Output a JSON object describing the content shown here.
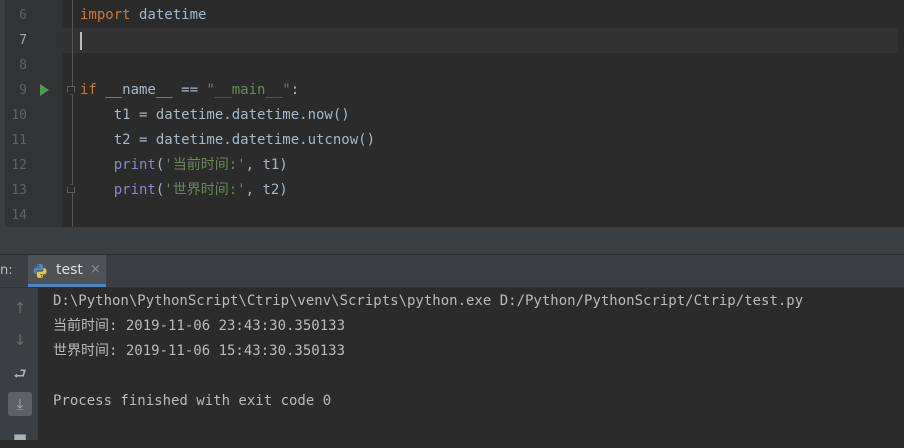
{
  "editor": {
    "lines": [
      {
        "num": "6"
      },
      {
        "num": "7"
      },
      {
        "num": "8"
      },
      {
        "num": "9"
      },
      {
        "num": "10"
      },
      {
        "num": "11"
      },
      {
        "num": "12"
      },
      {
        "num": "13"
      },
      {
        "num": "14"
      }
    ],
    "code": {
      "l6_kw": "import",
      "l6_rest": " datetime",
      "l9_kw": "if",
      "l9_mid": " __name__ == ",
      "l9_str": "\"__main__\"",
      "l9_end": ":",
      "l10": "    t1 = datetime.datetime.now()",
      "l11": "    t2 = datetime.datetime.utcnow()",
      "l12_fn": "    print",
      "l12_open": "(",
      "l12_str": "'当前时间:'",
      "l12_end": ", t1)",
      "l13_fn": "    print",
      "l13_open": "(",
      "l13_str": "'世界时间:'",
      "l13_end": ", t2)"
    }
  },
  "run_window": {
    "prefix": "n:",
    "tab_label": "test",
    "tab_close": "×"
  },
  "toolbar": {
    "up_icon": "↑",
    "down_icon": "↓",
    "wrap_icon": "⮐",
    "scroll_end_icon": "⤓",
    "print_icon": "▬"
  },
  "console": {
    "lines": [
      "D:\\Python\\PythonScript\\Ctrip\\venv\\Scripts\\python.exe D:/Python/PythonScript/Ctrip/test.py",
      "当前时间: 2019-11-06 23:43:30.350133",
      "世界时间: 2019-11-06 15:43:30.350133",
      "",
      "Process finished with exit code 0"
    ]
  },
  "colors": {
    "keyword": "#cc7832",
    "string": "#6a8759",
    "builtin": "#8888c6",
    "text": "#a9b7c6",
    "run_icon": "#499c54",
    "tab_underline": "#4a88c7"
  }
}
